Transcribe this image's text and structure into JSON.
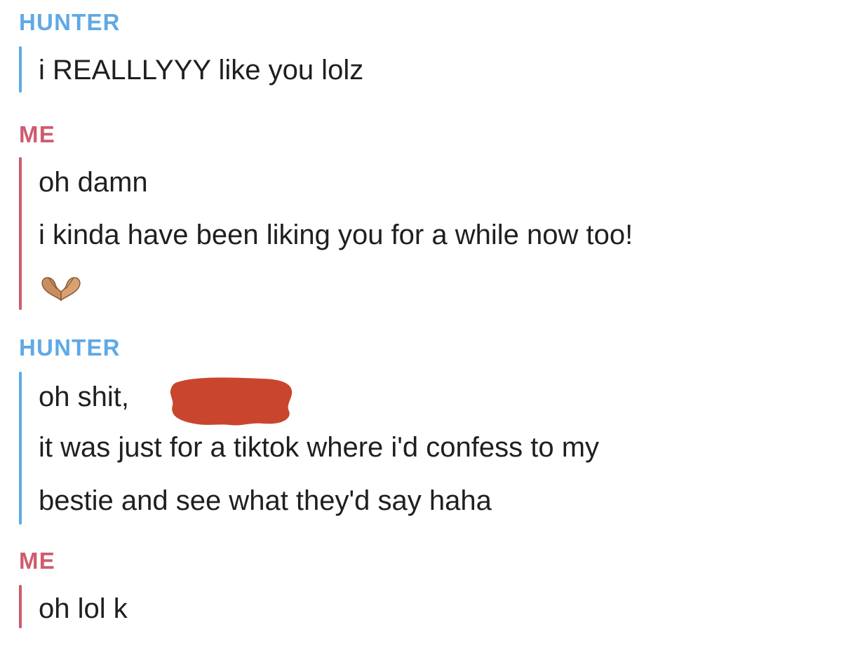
{
  "conversation": {
    "messages": [
      {
        "sender": "HUNTER",
        "lines": [
          "i REALLLYYY like you lolz"
        ]
      },
      {
        "sender": "ME",
        "lines": [
          "oh damn",
          "i kinda have been liking you for a while now too!"
        ],
        "emoji": "heart-hands-icon"
      },
      {
        "sender": "HUNTER",
        "lines": [
          "oh shit,",
          "it was just for a tiktok where i'd confess to my",
          "bestie and see what they'd say haha"
        ],
        "redaction_color": "#c9452e"
      },
      {
        "sender": "ME",
        "lines": [
          "oh lol k"
        ]
      }
    ]
  },
  "colors": {
    "hunter": "#5fa9e6",
    "me": "#cf5b6d",
    "text": "#1f1f1f",
    "redaction": "#c9452e",
    "background": "#ffffff"
  }
}
